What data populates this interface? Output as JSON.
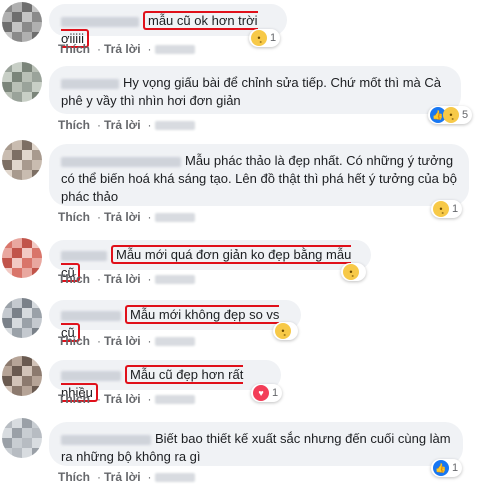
{
  "comments": [
    {
      "text": "",
      "highlight": "mẫu cũ ok hơn trời ơiiiii",
      "like_label": "Thích",
      "reply_label": "Trả lời",
      "reactions": [
        "sad-icon"
      ],
      "count": "1",
      "avatar": [
        "#8a8a8a",
        "#b0b0b0",
        "#6e6e6e",
        "#c4c4c4"
      ]
    },
    {
      "text": "Hy vọng giấu bài để chỉnh sửa tiếp. Chứ mốt thì mà Cà phê y vầy thì nhìn hơi đơn giản",
      "highlight": "",
      "like_label": "Thích",
      "reply_label": "Trả lời",
      "reactions": [
        "like-icon",
        "sad-icon"
      ],
      "count": "5",
      "avatar": [
        "#9aa39a",
        "#c8cfc6",
        "#7b857a",
        "#b9c0b6"
      ]
    },
    {
      "text": "Mẫu phác thảo là đẹp nhất. Có những ý tưởng có thể biến hoá khá sáng tạo. Lên đồ thật thì phá hết ý tưởng của bộ phác thảo",
      "highlight": "",
      "like_label": "Thích",
      "reply_label": "Trả lời",
      "reactions": [
        "sad-icon"
      ],
      "count": "1",
      "avatar": [
        "#a89a8e",
        "#c9bcb0",
        "#7d6f64",
        "#e0d6cc"
      ]
    },
    {
      "text": "",
      "highlight": "Mẫu mới quá đơn giản ko đẹp bằng mẫu cũ",
      "like_label": "Thích",
      "reply_label": "Trả lời",
      "reactions": [
        "sad-icon"
      ],
      "count": "",
      "avatar": [
        "#d9756a",
        "#e9a79f",
        "#c1544a",
        "#f2c9c3"
      ]
    },
    {
      "text": "",
      "highlight": "Mẫu mới không đẹp so vs cũ",
      "like_label": "Thích",
      "reply_label": "Trả lời",
      "reactions": [
        "sad-icon"
      ],
      "count": "",
      "avatar": [
        "#9aa1a8",
        "#c4c9cf",
        "#7a8189",
        "#d6dade"
      ]
    },
    {
      "text": "",
      "highlight": "Mẫu cũ đẹp hơn rất nhiều",
      "like_label": "Thích",
      "reply_label": "Trả lời",
      "reactions": [
        "love-icon"
      ],
      "count": "1",
      "avatar": [
        "#8c7a6e",
        "#b6a497",
        "#6a5a50",
        "#d2c3b8"
      ]
    },
    {
      "text": "Biết bao thiết kế xuất sắc nhưng đến cuối cùng làm ra những bộ không ra gì",
      "highlight": "",
      "like_label": "Thích",
      "reply_label": "Trả lời",
      "reactions": [
        "like-icon"
      ],
      "count": "1",
      "avatar": [
        "#b7bcc2",
        "#d8dce0",
        "#9aa0a7",
        "#c8cdd2"
      ]
    }
  ],
  "colors": {
    "highlight_border": "#e0101a",
    "bubble": "#f0f2f5",
    "meta": "#65676b"
  }
}
